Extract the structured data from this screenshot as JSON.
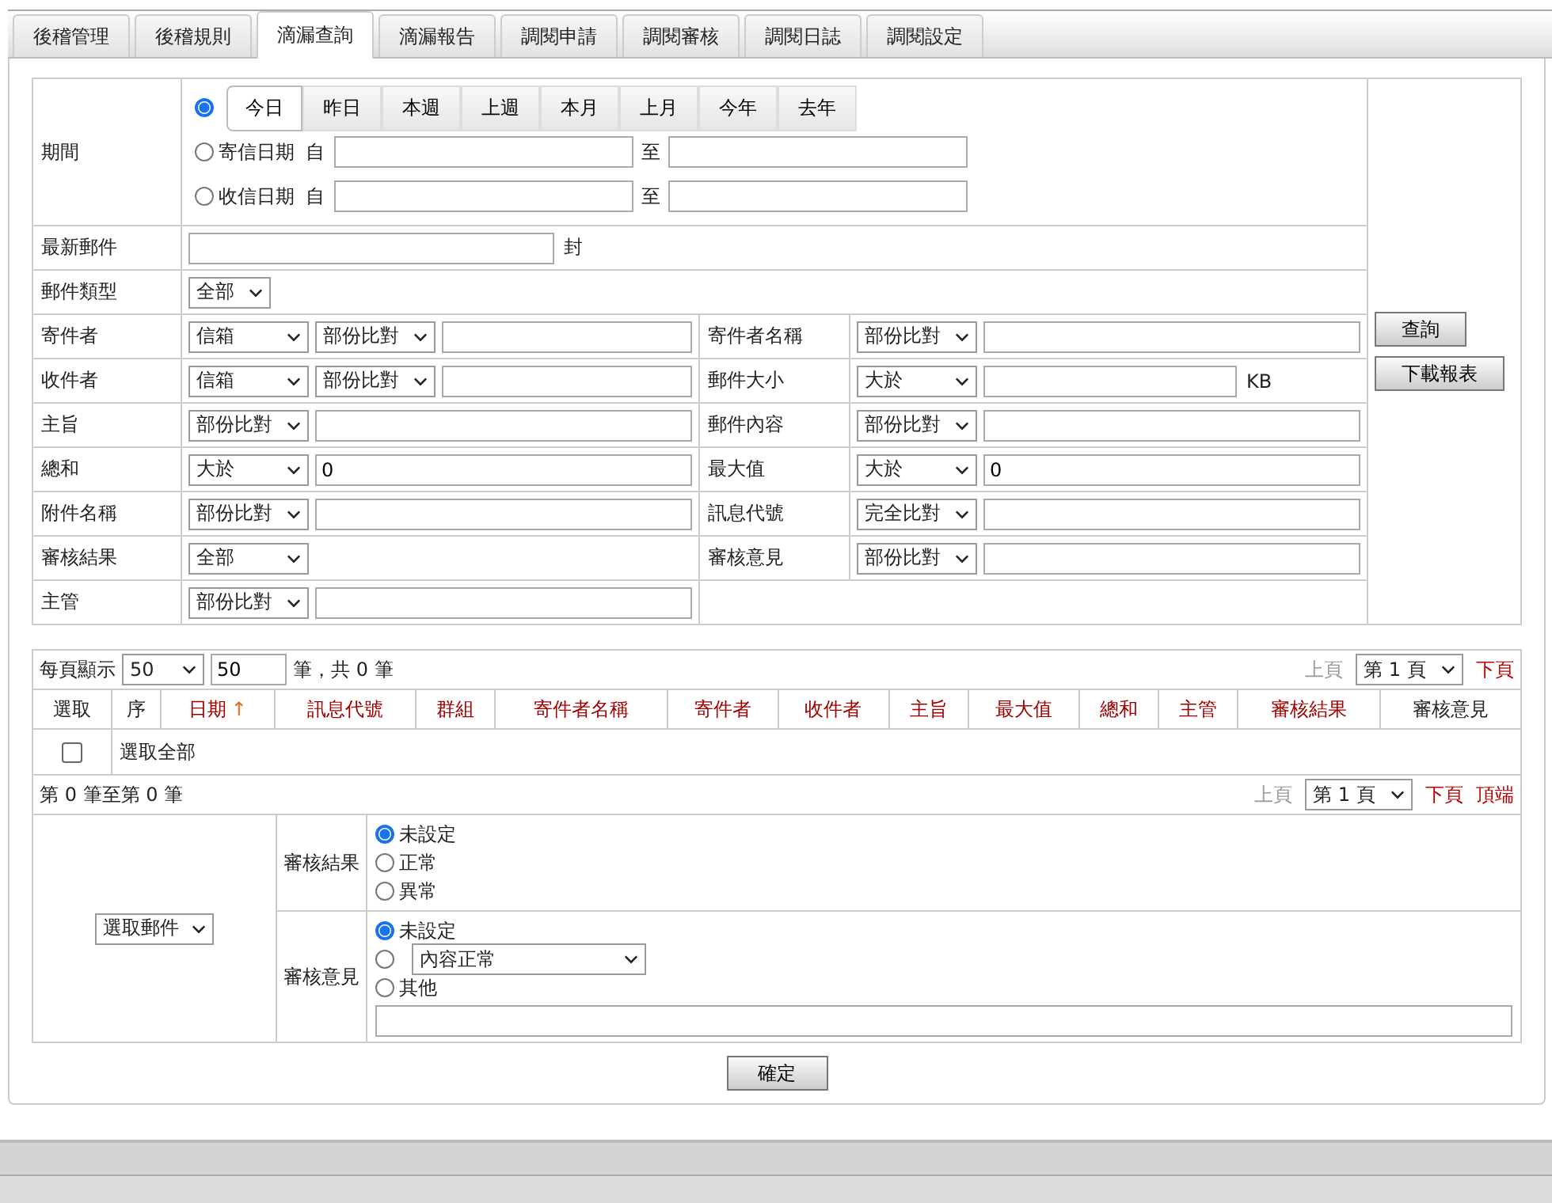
{
  "tabs": [
    {
      "label": "後稽管理",
      "selected": false
    },
    {
      "label": "後稽規則",
      "selected": false
    },
    {
      "label": "滴漏查詢",
      "selected": true
    },
    {
      "label": "滴漏報告",
      "selected": false
    },
    {
      "label": "調閱申請",
      "selected": false
    },
    {
      "label": "調閱審核",
      "selected": false
    },
    {
      "label": "調閱日誌",
      "selected": false
    },
    {
      "label": "調閱設定",
      "selected": false
    }
  ],
  "period": {
    "label": "期間",
    "quick": {
      "selected": true,
      "buttons": [
        {
          "label": "今日",
          "selected": true
        },
        {
          "label": "昨日",
          "selected": false
        },
        {
          "label": "本週",
          "selected": false
        },
        {
          "label": "上週",
          "selected": false
        },
        {
          "label": "本月",
          "selected": false
        },
        {
          "label": "上月",
          "selected": false
        },
        {
          "label": "今年",
          "selected": false
        },
        {
          "label": "去年",
          "selected": false
        }
      ]
    },
    "ranges": [
      {
        "label": "寄信日期",
        "selected": false,
        "from": "自",
        "to": "至"
      },
      {
        "label": "收信日期",
        "selected": false,
        "from": "自",
        "to": "至"
      }
    ]
  },
  "full_rows": [
    {
      "label": "最新郵件",
      "controls": [
        {
          "kind": "input"
        },
        {
          "kind": "unit",
          "text": "封"
        }
      ]
    },
    {
      "label": "郵件類型",
      "controls": [
        {
          "kind": "select",
          "value": "全部"
        }
      ]
    }
  ],
  "rows": [
    {
      "label": "寄件者",
      "controls": [
        {
          "kind": "select",
          "value": "信箱"
        },
        {
          "kind": "select",
          "value": "部份比對"
        },
        {
          "kind": "input"
        }
      ],
      "right": {
        "label": "寄件者名稱",
        "controls": [
          {
            "kind": "select",
            "value": "部份比對"
          },
          {
            "kind": "input"
          }
        ]
      }
    },
    {
      "label": "收件者",
      "controls": [
        {
          "kind": "select",
          "value": "信箱"
        },
        {
          "kind": "select",
          "value": "部份比對"
        },
        {
          "kind": "input"
        }
      ],
      "right": {
        "label": "郵件大小",
        "controls": [
          {
            "kind": "select",
            "value": "大於"
          },
          {
            "kind": "input"
          },
          {
            "kind": "unit",
            "text": "KB"
          }
        ]
      }
    },
    {
      "label": "主旨",
      "controls": [
        {
          "kind": "select",
          "value": "部份比對"
        },
        {
          "kind": "input"
        }
      ],
      "right": {
        "label": "郵件內容",
        "controls": [
          {
            "kind": "select",
            "value": "部份比對"
          },
          {
            "kind": "input"
          }
        ]
      }
    },
    {
      "label": "總和",
      "controls": [
        {
          "kind": "select",
          "value": "大於"
        },
        {
          "kind": "input",
          "value": "0"
        }
      ],
      "right": {
        "label": "最大值",
        "controls": [
          {
            "kind": "select",
            "value": "大於"
          },
          {
            "kind": "input",
            "value": "0"
          }
        ]
      }
    },
    {
      "label": "附件名稱",
      "controls": [
        {
          "kind": "select",
          "value": "部份比對"
        },
        {
          "kind": "input"
        }
      ],
      "right": {
        "label": "訊息代號",
        "controls": [
          {
            "kind": "select",
            "value": "完全比對"
          },
          {
            "kind": "input"
          }
        ]
      }
    },
    {
      "label": "審核結果",
      "controls": [
        {
          "kind": "select",
          "value": "全部"
        }
      ],
      "right": {
        "label": "審核意見",
        "controls": [
          {
            "kind": "select",
            "value": "部份比對"
          },
          {
            "kind": "input"
          }
        ]
      }
    },
    {
      "label": "主管",
      "controls": [
        {
          "kind": "select",
          "value": "部份比對"
        },
        {
          "kind": "input"
        }
      ]
    }
  ],
  "actions": [
    "查詢",
    "下載報表"
  ],
  "list": {
    "page_size_label": "每頁顯示",
    "page_size_select": "50",
    "page_size_input": "50",
    "total": "筆，共 0 筆",
    "top_pager": {
      "prev": "上頁",
      "page": "第 1 頁",
      "next": "下頁"
    },
    "columns": [
      {
        "label": "選取",
        "sortable": false
      },
      {
        "label": "序",
        "sortable": false
      },
      {
        "label": "日期",
        "sortable": true,
        "sort_arrow": "↑"
      },
      {
        "label": "訊息代號",
        "sortable": true
      },
      {
        "label": "群組",
        "sortable": true
      },
      {
        "label": "寄件者名稱",
        "sortable": true
      },
      {
        "label": "寄件者",
        "sortable": true
      },
      {
        "label": "收件者",
        "sortable": true
      },
      {
        "label": "主旨",
        "sortable": true
      },
      {
        "label": "最大值",
        "sortable": true
      },
      {
        "label": "總和",
        "sortable": true
      },
      {
        "label": "主管",
        "sortable": true
      },
      {
        "label": "審核結果",
        "sortable": true
      },
      {
        "label": "審核意見",
        "sortable": false
      }
    ],
    "select_all": {
      "label": "選取全部",
      "checked": false
    },
    "range_text": "第 0 筆至第 0 筆",
    "bottom_pager": {
      "prev": "上頁",
      "page": "第 1 頁",
      "next": "下頁",
      "top": "頂端"
    }
  },
  "review": {
    "mail_select": "選取郵件",
    "result": {
      "label": "審核結果",
      "options": [
        {
          "label": "未設定",
          "selected": true
        },
        {
          "label": "正常",
          "selected": false
        },
        {
          "label": "異常",
          "selected": false
        }
      ]
    },
    "opinion": {
      "label": "審核意見",
      "options": [
        {
          "kind": "text",
          "label": "未設定",
          "selected": true
        },
        {
          "kind": "select",
          "value": "內容正常",
          "selected": false
        },
        {
          "kind": "text",
          "label": "其他",
          "selected": false
        }
      ]
    },
    "confirm": "確定"
  }
}
